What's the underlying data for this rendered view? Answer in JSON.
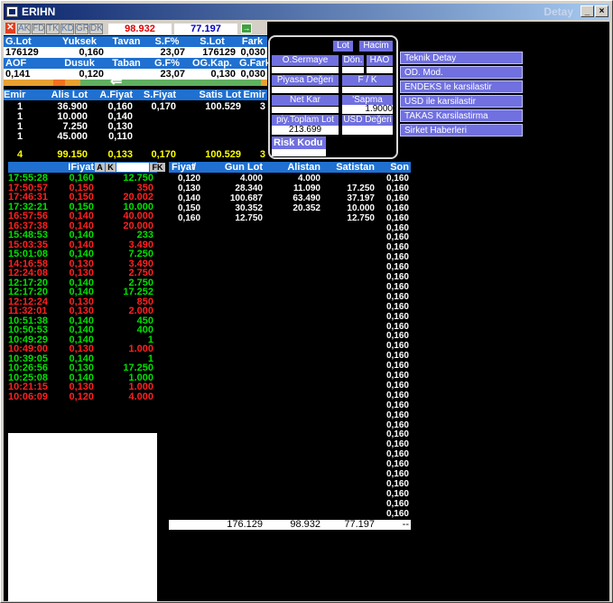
{
  "window": {
    "title": "ERIHN",
    "title_right": "Detay",
    "min": "_",
    "close": "×"
  },
  "toolbar": {
    "buttons": [
      "AK",
      "FD",
      "TK",
      "KD",
      "GR",
      "DK"
    ],
    "value1": "98.932",
    "value2": "77.197"
  },
  "summary": {
    "h1": [
      "G.Lot",
      "Yuksek",
      "Tavan",
      "S.F%",
      "S.Lot",
      "Fark"
    ],
    "r1": [
      "176129",
      "0,160",
      "",
      "23,07",
      "176129",
      "0,030"
    ],
    "h2": [
      "AOF",
      "Dusuk",
      "Taban",
      "G.F%",
      "OG.Kap.",
      "G.Fark"
    ],
    "r2": [
      "0,141",
      "0,120",
      "",
      "23,07",
      "0,130",
      "0,030"
    ],
    "arrow": "⇐"
  },
  "depth": {
    "header": [
      "Emir",
      "Alis Lot",
      "A.Fiyat",
      "S.Fiyat",
      "Satis Lot",
      "Emir"
    ],
    "rows": [
      [
        "1",
        "36.900",
        "0,160",
        "0,170",
        "100.529",
        "3"
      ],
      [
        "1",
        "10.000",
        "0,140",
        "",
        "",
        ""
      ],
      [
        "1",
        "7.250",
        "0,130",
        "",
        "",
        ""
      ],
      [
        "1",
        "45.000",
        "0,110",
        "",
        "",
        ""
      ]
    ],
    "total": [
      "4",
      "99.150",
      "0,133",
      "0,170",
      "100.529",
      "3"
    ]
  },
  "popup": {
    "lot": "Lot",
    "hacim": "Hacim",
    "osermaye": "O.Sermaye",
    "don": "Dön.",
    "hao": "HAO",
    "piyasa_degeri": "Piyasa Değeri",
    "fk": "F / K",
    "net_kar": "Net Kar",
    "sapma": "'Sapma",
    "sapma_val": "1.9000",
    "piy_toplam_lot": "piy.Toplam Lot",
    "piy_toplam_val": "213.699",
    "usd_degeri": "USD Değeri",
    "risk_kodu": "Risk Kodu"
  },
  "side_menu": [
    "Teknik Detay",
    "OD. Mod.",
    "ENDEKS le karsilastir",
    "USD ile karsilastir",
    "TAKAS Karsilastirma",
    "Sirket Haberleri"
  ],
  "trades": {
    "header": {
      "fiyat": "IFiyat",
      "a": "A",
      "k": "K",
      "fk": "FK"
    },
    "rows": [
      {
        "t": "17:55:28",
        "p": "0,160",
        "q": "12.750",
        "c": "grn"
      },
      {
        "t": "17:50:57",
        "p": "0,150",
        "q": "350",
        "c": "red"
      },
      {
        "t": "17:46:31",
        "p": "0,150",
        "q": "20.002",
        "c": "red"
      },
      {
        "t": "17:32:21",
        "p": "0,150",
        "q": "10.000",
        "c": "grn"
      },
      {
        "t": "16:57:56",
        "p": "0,140",
        "q": "40.000",
        "c": "red"
      },
      {
        "t": "16:37:38",
        "p": "0,140",
        "q": "20.000",
        "c": "red"
      },
      {
        "t": "15:48:53",
        "p": "0,140",
        "q": "233",
        "c": "grn"
      },
      {
        "t": "15:03:35",
        "p": "0,140",
        "q": "3.490",
        "c": "red"
      },
      {
        "t": "15:01:08",
        "p": "0,140",
        "q": "7.250",
        "c": "grn"
      },
      {
        "t": "14:16:58",
        "p": "0,130",
        "q": "3.490",
        "c": "red"
      },
      {
        "t": "12:24:08",
        "p": "0,130",
        "q": "2.750",
        "c": "red"
      },
      {
        "t": "12:17:20",
        "p": "0,140",
        "q": "2.750",
        "c": "grn"
      },
      {
        "t": "12:17:20",
        "p": "0,140",
        "q": "17.252",
        "c": "grn"
      },
      {
        "t": "12:12:24",
        "p": "0,130",
        "q": "850",
        "c": "red"
      },
      {
        "t": "11:32:01",
        "p": "0,130",
        "q": "2.000",
        "c": "red"
      },
      {
        "t": "10:51:38",
        "p": "0,140",
        "q": "450",
        "c": "grn"
      },
      {
        "t": "10:50:53",
        "p": "0,140",
        "q": "400",
        "c": "grn"
      },
      {
        "t": "10:49:29",
        "p": "0,140",
        "q": "1",
        "c": "grn"
      },
      {
        "t": "10:49:00",
        "p": "0,130",
        "q": "1.000",
        "c": "red"
      },
      {
        "t": "10:39:05",
        "p": "0,140",
        "q": "1",
        "c": "grn"
      },
      {
        "t": "10:26:56",
        "p": "0,130",
        "q": "17.250",
        "c": "grn"
      },
      {
        "t": "10:25:08",
        "p": "0,140",
        "q": "1.000",
        "c": "grn"
      },
      {
        "t": "10:21:15",
        "p": "0,130",
        "q": "1.000",
        "c": "red"
      },
      {
        "t": "10:06:09",
        "p": "0,120",
        "q": "4.000",
        "c": "red"
      }
    ]
  },
  "price_table": {
    "header": [
      "Fiyat",
      "Gun Lot",
      "Alistan",
      "Satistan",
      "Son"
    ],
    "sort_mark": "/",
    "rows": [
      [
        "0,120",
        "4.000",
        "4.000",
        ""
      ],
      [
        "0,130",
        "28.340",
        "11.090",
        "17.250"
      ],
      [
        "0,140",
        "100.687",
        "63.490",
        "37.197"
      ],
      [
        "0,150",
        "30.352",
        "20.352",
        "10.000"
      ],
      [
        "0,160",
        "12.750",
        "",
        "12.750"
      ]
    ],
    "son_value": "0,160",
    "son_count": 36,
    "total": [
      "",
      "176.129",
      "98.932",
      "77.197",
      "--"
    ]
  }
}
